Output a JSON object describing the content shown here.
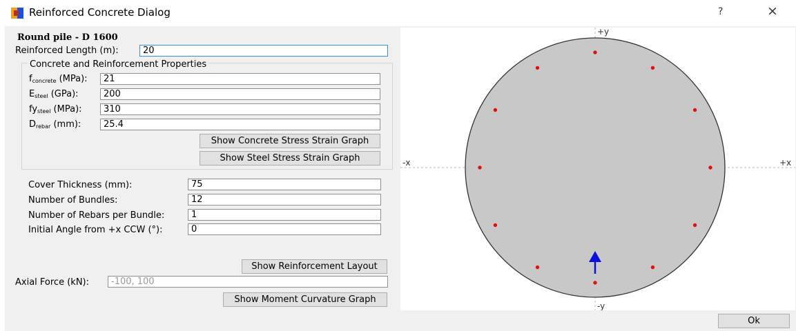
{
  "window": {
    "title": "Reinforced Concrete Dialog",
    "help": "?",
    "close": "×"
  },
  "section": {
    "heading": "Round pile - D 1600",
    "length_label": "Reinforced Length (m):",
    "length_value": "20"
  },
  "properties": {
    "group_title": "Concrete and Reinforcement Properties",
    "fconcrete_label": "f",
    "fconcrete_sub": "concrete",
    "fconcrete_unit": " (MPa):",
    "fconcrete_value": "21",
    "esteel_label": "E",
    "esteel_sub": "steel",
    "esteel_unit": " (GPa):",
    "esteel_value": "200",
    "fysteel_label": "fy",
    "fysteel_sub": "steel",
    "fysteel_unit": " (MPa):",
    "fysteel_value": "310",
    "drebar_label": "D",
    "drebar_sub": "rebar",
    "drebar_unit": " (mm):",
    "drebar_value": "25.4",
    "concrete_graph_button": "Show Concrete Stress Strain Graph",
    "steel_graph_button": "Show Steel Stress Strain Graph"
  },
  "layout": {
    "cover_label": "Cover Thickness (mm):",
    "cover_value": "75",
    "bundles_label": "Number of Bundles:",
    "bundles_value": "12",
    "per_bundle_label": "Number of Rebars per Bundle:",
    "per_bundle_value": "1",
    "angle_label": "Initial Angle from +x CCW (°):",
    "angle_value": "0",
    "reinforcement_button": "Show Reinforcement Layout"
  },
  "axial": {
    "label": "Axial Force (kN):",
    "placeholder": "-100, 100",
    "moment_button": "Show Moment Curvature Graph"
  },
  "plot": {
    "pos_y": "+y",
    "neg_y": "-y",
    "neg_x": "-x",
    "pos_x": "+x",
    "rebar_count": 12,
    "initial_angle_deg": 0,
    "section_fill": "#c8c8c8",
    "rebar_color": "#e01010",
    "arrow_color": "#0a10d8"
  },
  "footer": {
    "ok_button": "Ok"
  }
}
